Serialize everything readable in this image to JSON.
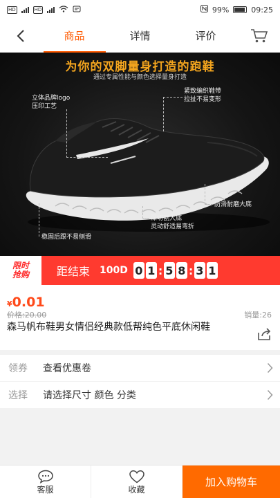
{
  "status_bar": {
    "left_badges": [
      "HD",
      "4G",
      "HD",
      "4G"
    ],
    "battery": "99%",
    "time": "09:25"
  },
  "nav": {
    "tabs": [
      "商品",
      "详情",
      "评价"
    ],
    "active_tab": "商品"
  },
  "product_image": {
    "headline": "为你的双脚量身打造的跑鞋",
    "subheadline": "通过专属性能与颜色选择量身打造",
    "callouts": {
      "logo": "立体品牌logo\n压印工艺",
      "laces": "紧致编织鞋带\n拉扯不易变形",
      "sole_grip": "防滑耐磨大底",
      "deep_cut": "深切割大底\n灵动舒适易弯折",
      "heel": "稳固后跟不易侧滑"
    }
  },
  "flash_sale": {
    "logo_line1": "限时",
    "logo_line2": "抢购",
    "label": "距结束",
    "days": "100D",
    "hours": [
      "0",
      "1"
    ],
    "minutes": [
      "5",
      "8"
    ],
    "seconds": [
      "3",
      "1"
    ]
  },
  "product": {
    "price_symbol": "¥",
    "price": "0.01",
    "original_price": "价格:20.00",
    "sales": "销量:26",
    "title": "森马帆布鞋男女情侣经典款低帮纯色平底休闲鞋"
  },
  "coupon_row": {
    "label": "领券",
    "value": "查看优惠卷"
  },
  "spec_row": {
    "label": "选择",
    "value": "请选择尺寸 颜色 分类"
  },
  "bottom_bar": {
    "service_label": "客服",
    "favorite_label": "收藏",
    "cart_label": "加入购物车"
  },
  "colors": {
    "accent": "#ff5a00",
    "flash_red": "#ff3a2f",
    "price": "#ff4a1a"
  }
}
